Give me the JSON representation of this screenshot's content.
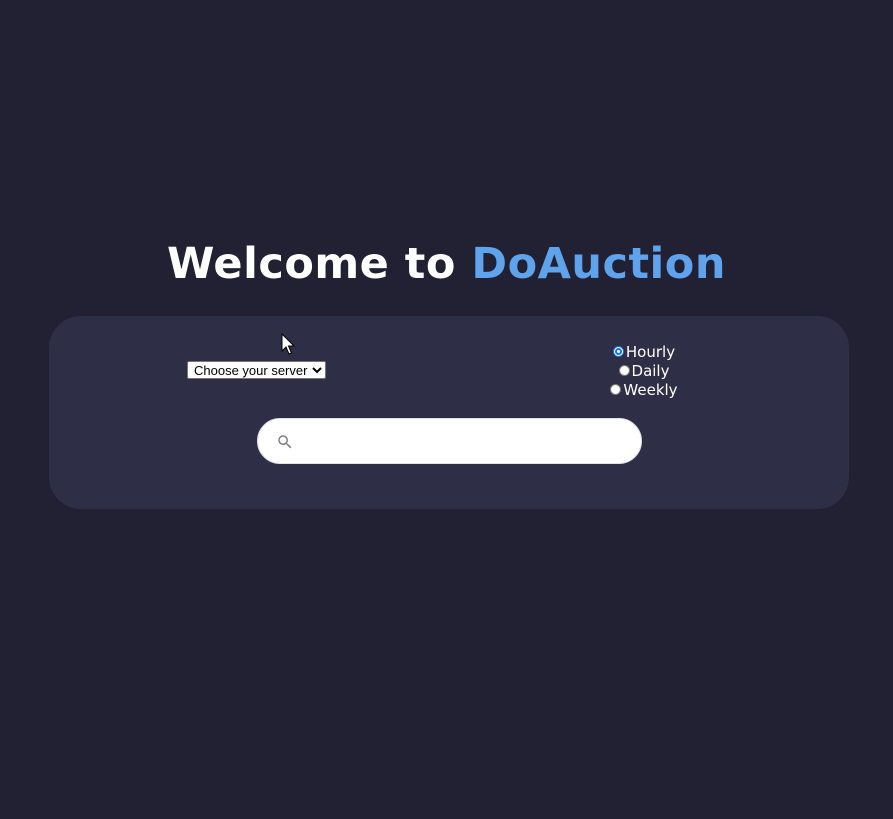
{
  "header": {
    "title_prefix": "Welcome to",
    "title_brand": "DoAuction"
  },
  "server": {
    "selected": "Choose your server"
  },
  "period": {
    "options": [
      {
        "label": "Hourly",
        "checked": true
      },
      {
        "label": "Daily",
        "checked": false
      },
      {
        "label": "Weekly",
        "checked": false
      }
    ]
  },
  "search": {
    "icon": "search-icon",
    "value": "",
    "placeholder": ""
  },
  "colors": {
    "background": "#222133",
    "panel": "#2e2f46",
    "brand": "#5ea3ec",
    "text": "#ffffff"
  }
}
